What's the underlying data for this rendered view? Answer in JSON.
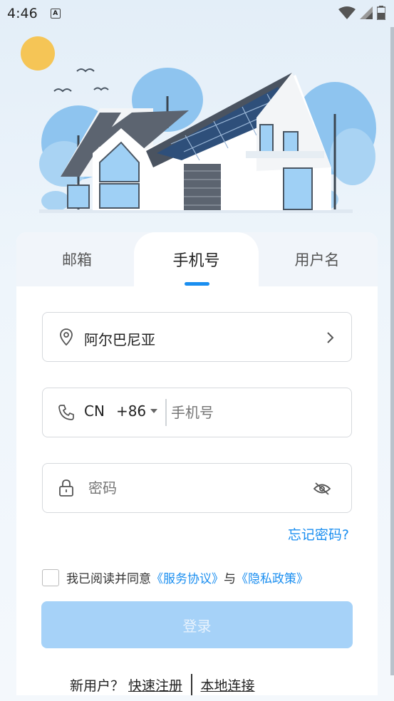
{
  "status_bar": {
    "time": "4:46",
    "notification_icon": "A"
  },
  "tabs": [
    {
      "label": "邮箱",
      "active": false
    },
    {
      "label": "手机号",
      "active": true
    },
    {
      "label": "用户名",
      "active": false
    }
  ],
  "form": {
    "region_value": "阿尔巴尼亚",
    "phone_country": "CN",
    "phone_code": "+86",
    "phone_placeholder": "手机号",
    "password_placeholder": "密码",
    "forgot_password": "忘记密码?"
  },
  "agreement": {
    "prefix": "我已阅读并同意",
    "service_link": "《服务协议》",
    "conjunction": "与",
    "privacy_link": "《隐私政策》",
    "checked": false
  },
  "login_button": "登录",
  "footer": {
    "new_user": "新用户？",
    "quick_register": "快速注册",
    "local_connect": "本地连接"
  },
  "colors": {
    "accent": "#1a8ef0",
    "login_button_disabled": "#a6d2f8"
  }
}
